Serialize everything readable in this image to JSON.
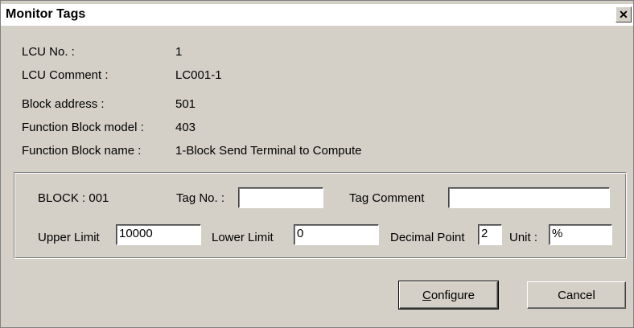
{
  "window": {
    "title": "Monitor Tags",
    "close_glyph": "✕"
  },
  "info": {
    "lcu_no_label": "LCU No. :",
    "lcu_no_value": "1",
    "lcu_comment_label": "LCU Comment :",
    "lcu_comment_value": "LC001-1",
    "block_address_label": "Block address :",
    "block_address_value": "501",
    "fb_model_label": "Function Block model :",
    "fb_model_value": "403",
    "fb_name_label": "Function Block name :",
    "fb_name_value": "1-Block Send Terminal to Compute"
  },
  "block": {
    "block_label": "BLOCK :  001",
    "tag_no_label": "Tag No. :",
    "tag_no_value": "",
    "tag_comment_label": "Tag Comment",
    "tag_comment_value": "",
    "upper_limit_label": "Upper Limit",
    "upper_limit_value": "10000",
    "lower_limit_label": "Lower Limit",
    "lower_limit_value": "0",
    "decimal_point_label": "Decimal Point",
    "decimal_point_value": "2",
    "unit_label": "Unit :",
    "unit_value": "%"
  },
  "buttons": {
    "configure_first": "C",
    "configure_rest": "onfigure",
    "cancel": "Cancel"
  }
}
